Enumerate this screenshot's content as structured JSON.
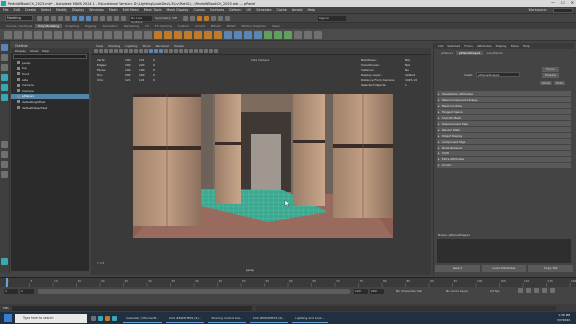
{
  "title": "PedroWBookCh_2023.mb* - Autodesk MAYA 2024.1 - Educational Version: D:\\Lighting\\LookDev\\L3\\Lv\\Poe01\\...\\PedroWBookCh_2023.mb --- pPanel",
  "window_controls": [
    "—",
    "☐",
    "✕"
  ],
  "menu": [
    "File",
    "Edit",
    "Create",
    "Select",
    "Modify",
    "Display",
    "Windows",
    "Mesh",
    "Edit Mesh",
    "Mesh Tools",
    "Mesh Display",
    "Curves",
    "Surfaces",
    "Deform",
    "UV",
    "Generate",
    "Cache",
    "Arnold",
    "Help"
  ],
  "workspace_label": "Workspace:",
  "status": {
    "mode": "Modeling",
    "live": "No Live Surface",
    "symmetry": "Symmetry: Off",
    "sign_in": "Sign In"
  },
  "shelf_tabs": [
    "Curves / Surfaces",
    "Poly Modeling",
    "Sculpting",
    "Rigging",
    "Animation",
    "Rendering",
    "FX",
    "FX Caching",
    "Custom",
    "Arnold",
    "Bifrost",
    "MASH",
    "Motion Graphics",
    "XGen"
  ],
  "shelf_active": "Poly Modeling",
  "outliner": {
    "title": "Outliner",
    "menu": [
      "Display",
      "Show",
      "Help"
    ],
    "items": [
      "persp",
      "top",
      "front",
      "side",
      "Camera",
      "Camera",
      "pPlane1",
      "defaultLightSet",
      "defaultObjectSet"
    ],
    "selected": "pPlane1"
  },
  "viewport": {
    "menu": [
      "View",
      "Shading",
      "Lighting",
      "Show",
      "Renderer",
      "Panels"
    ],
    "hud_title": "Side Camera",
    "stats_left": [
      {
        "label": "Verts:",
        "a": "100",
        "b": "121",
        "c": "0"
      },
      {
        "label": "Edges:",
        "a": "200",
        "b": "220",
        "c": "0"
      },
      {
        "label": "Faces:",
        "a": "100",
        "b": "100",
        "c": "0"
      },
      {
        "label": "Tris:",
        "a": "200",
        "b": "200",
        "c": "0"
      },
      {
        "label": "UVs:",
        "a": "121",
        "b": "121",
        "c": "0"
      }
    ],
    "stats_right": [
      {
        "label": "Backfaces:",
        "value": "N/A"
      },
      {
        "label": "Smoothness:",
        "value": "N/A"
      },
      {
        "label": "Instance:",
        "value": "No"
      },
      {
        "label": "Display Layer:",
        "value": "default"
      },
      {
        "label": "Distance From Camera:",
        "value": "1025.19"
      },
      {
        "label": "Selected Objects:",
        "value": "1"
      }
    ],
    "camera": "persp",
    "axes": "Y X Z"
  },
  "attribute_editor": {
    "tabs": [
      "List",
      "Selected",
      "Focus",
      "Attributes",
      "Display",
      "Show",
      "Help"
    ],
    "node_tabs": [
      "pPlane1",
      "pPlaneShape1",
      "polyPlane1"
    ],
    "node_label": "mesh:",
    "node_value": "pPlaneShape1",
    "focus_button": "Focus",
    "presets_button": "Presets",
    "show_button": "Show",
    "hide_button": "Hide",
    "sections": [
      "Tessellation Attributes",
      "Mesh Component Display",
      "Mesh Controls",
      "Tangent Space",
      "Smooth Mesh",
      "Displacement Map",
      "Render Stats",
      "Object Display",
      "Component Tags",
      "Node Behavior",
      "UUID",
      "Extra Attributes",
      "Arnold",
      "Notes: pPlaneShape1"
    ],
    "notes": "Notes: pPlaneShape1",
    "buttons": [
      "Select",
      "Load Attributes",
      "Copy Tab"
    ]
  },
  "time": {
    "ticks": [
      "1",
      "5",
      "10",
      "15",
      "20",
      "25",
      "30",
      "35",
      "40",
      "45",
      "50",
      "55",
      "60",
      "65",
      "70",
      "75",
      "80",
      "85",
      "90",
      "95",
      "100",
      "105",
      "110",
      "115",
      "120"
    ],
    "range_start": "1",
    "range_end": "120",
    "anim_end": "200",
    "current_frame": "1",
    "no_character": "No Character Set",
    "no_anim_layer": "No Anim Layer",
    "fps": "24 fps"
  },
  "cmdline": {
    "label": "MEL"
  },
  "taskbar": {
    "search": "Type here to search",
    "tasks": [
      "Calendar | Microsoft...",
      "CXA #KW2HE29 (2)...",
      "Sharing control bar...",
      "CXA #KW2HE29 (2)...",
      "Lighting and Look..."
    ],
    "time": "1:36 PM",
    "date": "3/7/2024"
  },
  "colors": {
    "accent": "#5285a6",
    "panel": "#444444",
    "dark": "#2b2b2b",
    "ground": "#3ba88f"
  }
}
